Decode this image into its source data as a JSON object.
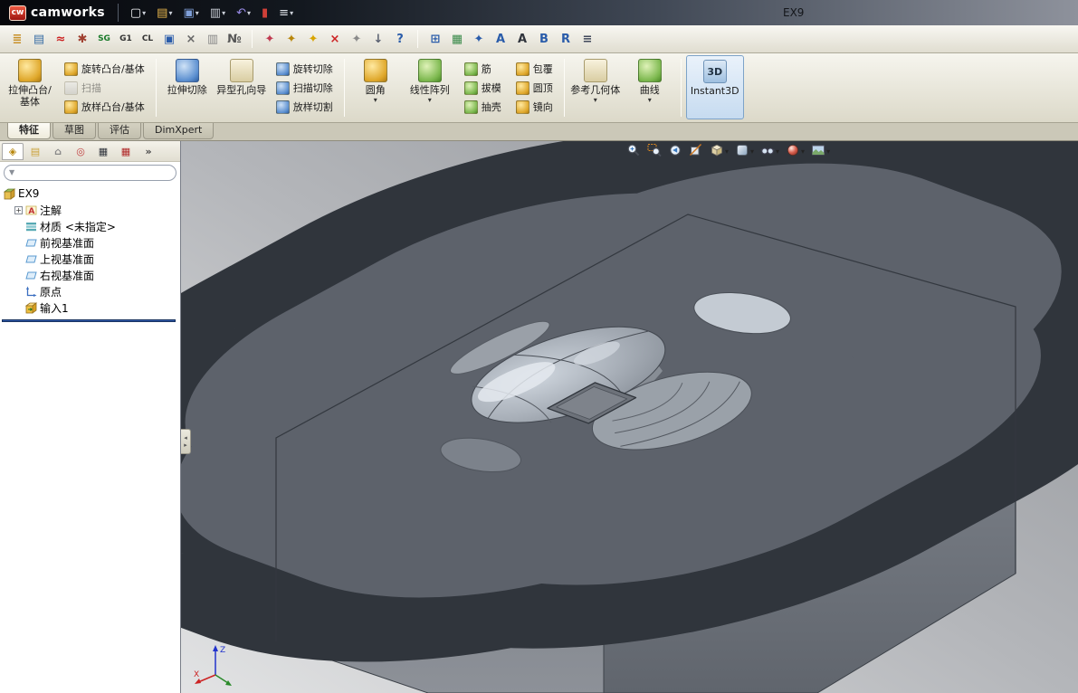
{
  "titlebar": {
    "logo_badge": "cw",
    "logo_text": "camworks",
    "document_title": "EX9",
    "quick_icons": [
      {
        "name": "new-document-icon",
        "glyph": "▢",
        "color": "#f5f6f8",
        "dropdown": true
      },
      {
        "name": "open-folder-icon",
        "glyph": "▤",
        "color": "#e8b64c",
        "dropdown": true
      },
      {
        "name": "save-icon",
        "glyph": "▣",
        "color": "#7f9fd8",
        "dropdown": true
      },
      {
        "name": "print-icon",
        "glyph": "▥",
        "color": "#c8ccd4",
        "dropdown": true
      },
      {
        "name": "undo-icon",
        "glyph": "↶",
        "color": "#9a8ce8",
        "dropdown": true
      },
      {
        "name": "rebuild-stoplight-icon",
        "glyph": "▮",
        "color": "#d04038",
        "dropdown": false
      },
      {
        "name": "options-list-icon",
        "glyph": "≡",
        "color": "#dde1e8",
        "dropdown": true
      }
    ]
  },
  "camworks_toolbar": {
    "groups": [
      {
        "icons": [
          {
            "name": "stack-gold-icon",
            "glyph": "≣",
            "color": "#c8912a"
          },
          {
            "name": "notebook-icon",
            "glyph": "▤",
            "color": "#3a6ea5"
          },
          {
            "name": "red-wave-icon",
            "glyph": "≈",
            "color": "#cc2222"
          },
          {
            "name": "gear-icon",
            "glyph": "✱",
            "color": "#a04030"
          },
          {
            "name": "sg-badge-icon",
            "glyph": "SG",
            "color": "#1a7a2a"
          },
          {
            "name": "g1-badge-icon",
            "glyph": "G1",
            "color": "#333333"
          },
          {
            "name": "cl-badge-icon",
            "glyph": "CL",
            "color": "#333333"
          },
          {
            "name": "monitor-icon",
            "glyph": "▣",
            "color": "#2a5caa"
          },
          {
            "name": "scissors-icon",
            "glyph": "×",
            "color": "#666666"
          },
          {
            "name": "sheet-icon",
            "glyph": "▥",
            "color": "#888888"
          },
          {
            "name": "numbered-list-icon",
            "glyph": "№",
            "color": "#555555"
          }
        ]
      },
      {
        "icons": [
          {
            "name": "drill-red-icon",
            "glyph": "✦",
            "color": "#c03a50"
          },
          {
            "name": "drill-gold-icon",
            "glyph": "✦",
            "color": "#b8860b"
          },
          {
            "name": "drill-yellow-icon",
            "glyph": "✦",
            "color": "#d8a400"
          },
          {
            "name": "drill-cross-red-icon",
            "glyph": "×",
            "color": "#cc2222"
          },
          {
            "name": "drill-gray-icon",
            "glyph": "✦",
            "color": "#8a8a8a"
          },
          {
            "name": "down-arrow-icon",
            "glyph": "↓",
            "color": "#5a6070"
          },
          {
            "name": "help-icon",
            "glyph": "?",
            "color": "#2a5caa"
          }
        ]
      },
      {
        "icons": [
          {
            "name": "grid-plus-icon",
            "glyph": "⊞",
            "color": "#2a5caa"
          },
          {
            "name": "checklist-icon",
            "glyph": "▦",
            "color": "#3a8a4a"
          },
          {
            "name": "drill-blue-icon",
            "glyph": "✦",
            "color": "#2a5caa"
          },
          {
            "name": "letter-a-blue-icon",
            "glyph": "A",
            "color": "#2a5caa"
          },
          {
            "name": "letter-a-dark-icon",
            "glyph": "A",
            "color": "#30343c"
          },
          {
            "name": "letter-b-blue-icon",
            "glyph": "B",
            "color": "#2a5caa"
          },
          {
            "name": "letter-r-blue-icon",
            "glyph": "R",
            "color": "#2a5caa"
          },
          {
            "name": "list-equals-icon",
            "glyph": "≡",
            "color": "#40485a"
          }
        ]
      }
    ]
  },
  "ribbon": {
    "items": [
      {
        "kind": "large",
        "name": "extruded-boss-base-button",
        "label": "拉伸凸台/基体",
        "style": "gold",
        "dropdown": false
      },
      {
        "kind": "stack",
        "buttons": [
          {
            "name": "revolved-boss-base-button",
            "label": "旋转凸台/基体",
            "style": "gold",
            "disabled": false
          },
          {
            "name": "swept-boss-base-button",
            "label": "扫描",
            "style": "gray",
            "disabled": true
          },
          {
            "name": "lofted-boss-base-button",
            "label": "放样凸台/基体",
            "style": "gold",
            "disabled": false
          }
        ]
      },
      {
        "kind": "sep"
      },
      {
        "kind": "large",
        "name": "extruded-cut-button",
        "label": "拉伸切除",
        "style": "blue",
        "dropdown": false
      },
      {
        "kind": "large",
        "name": "hole-wizard-button",
        "label": "异型孔向导",
        "style": "cream",
        "dropdown": false
      },
      {
        "kind": "stack",
        "buttons": [
          {
            "name": "revolved-cut-button",
            "label": "旋转切除",
            "style": "blue",
            "disabled": false
          },
          {
            "name": "swept-cut-button",
            "label": "扫描切除",
            "style": "blue",
            "disabled": false
          },
          {
            "name": "lofted-cut-button",
            "label": "放样切割",
            "style": "blue",
            "disabled": false
          }
        ]
      },
      {
        "kind": "sep"
      },
      {
        "kind": "large",
        "name": "fillet-button",
        "label": "圆角",
        "style": "gold",
        "dropdown": true
      },
      {
        "kind": "large",
        "name": "linear-pattern-button",
        "label": "线性阵列",
        "style": "green",
        "dropdown": true
      },
      {
        "kind": "stack",
        "buttons": [
          {
            "name": "rib-button",
            "label": "筋",
            "style": "green",
            "disabled": false
          },
          {
            "name": "draft-button",
            "label": "拔模",
            "style": "green",
            "disabled": false
          },
          {
            "name": "shell-button",
            "label": "抽壳",
            "style": "green",
            "disabled": false
          }
        ]
      },
      {
        "kind": "stack",
        "buttons": [
          {
            "name": "wrap-button",
            "label": "包覆",
            "style": "gold",
            "disabled": false
          },
          {
            "name": "dome-button",
            "label": "圆顶",
            "style": "gold",
            "disabled": false
          },
          {
            "name": "mirror-button",
            "label": "镜向",
            "style": "gold",
            "disabled": false
          }
        ]
      },
      {
        "kind": "sep"
      },
      {
        "kind": "large",
        "name": "reference-geometry-button",
        "label": "参考几何体",
        "style": "cream",
        "dropdown": true
      },
      {
        "kind": "large",
        "name": "curves-button",
        "label": "曲线",
        "style": "green",
        "dropdown": true
      },
      {
        "kind": "sep"
      },
      {
        "kind": "large",
        "name": "instant3d-button",
        "label": "Instant3D",
        "style": "instant",
        "dropdown": false,
        "active": true
      }
    ]
  },
  "command_tabs": {
    "active_index": 0,
    "tabs": [
      {
        "name": "tab-features",
        "label": "特征"
      },
      {
        "name": "tab-sketch",
        "label": "草图"
      },
      {
        "name": "tab-evaluate",
        "label": "评估"
      },
      {
        "name": "tab-dimxpert",
        "label": "DimXpert"
      }
    ]
  },
  "feature_tree": {
    "tabs": [
      {
        "name": "featuremanager-tree-tab",
        "glyph": "◈",
        "color": "#b8860b",
        "active": true
      },
      {
        "name": "propertymanager-tab",
        "glyph": "▤",
        "color": "#caa23a",
        "active": false
      },
      {
        "name": "configurationmanager-tab",
        "glyph": "⌂",
        "color": "#888888",
        "active": false
      },
      {
        "name": "dimxpertmanager-tab",
        "glyph": "◎",
        "color": "#c04040",
        "active": false
      },
      {
        "name": "camworks-feature-tree-tab",
        "glyph": "▦",
        "color": "#30343c",
        "active": false
      },
      {
        "name": "camworks-operation-tree-tab",
        "glyph": "▦",
        "color": "#b02828",
        "active": false
      },
      {
        "name": "panel-tabs-overflow",
        "glyph": "»",
        "color": "#444444",
        "active": false
      }
    ],
    "filter_value": "",
    "root_label": "EX9",
    "items": [
      {
        "label": "注解",
        "icon": "annotations",
        "expandable": true
      },
      {
        "label": "材质 <未指定>",
        "icon": "material",
        "expandable": false
      },
      {
        "label": "前视基准面",
        "icon": "plane",
        "expandable": false
      },
      {
        "label": "上视基准面",
        "icon": "plane",
        "expandable": false
      },
      {
        "label": "右视基准面",
        "icon": "plane",
        "expandable": false
      },
      {
        "label": "原点",
        "icon": "origin",
        "expandable": false
      },
      {
        "label": "输入1",
        "icon": "imported",
        "expandable": false
      }
    ]
  },
  "viewport": {
    "headsup": [
      {
        "name": "zoom-to-fit-button",
        "icon": "zoom-fit",
        "dropdown": false
      },
      {
        "name": "zoom-to-area-button",
        "icon": "zoom-area",
        "dropdown": false
      },
      {
        "name": "previous-view-button",
        "icon": "prev-view",
        "dropdown": false
      },
      {
        "name": "section-view-button",
        "icon": "section",
        "dropdown": false
      },
      {
        "name": "view-orientation-button",
        "icon": "cube",
        "dropdown": true
      },
      {
        "name": "display-style-button",
        "icon": "display",
        "dropdown": true
      },
      {
        "name": "hide-show-items-button",
        "icon": "glasses",
        "dropdown": true
      },
      {
        "name": "edit-appearance-button",
        "icon": "sphere",
        "dropdown": true
      },
      {
        "name": "apply-scene-button",
        "icon": "scene",
        "dropdown": true
      }
    ],
    "triad": {
      "x": "X",
      "z": "Z"
    }
  }
}
